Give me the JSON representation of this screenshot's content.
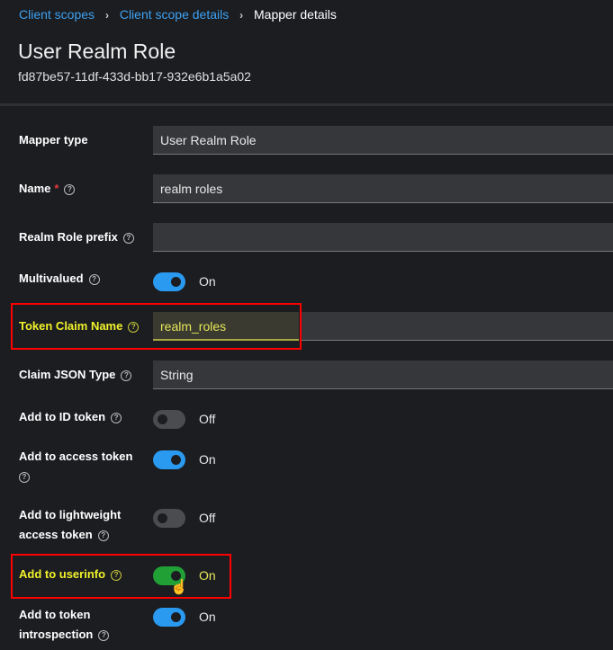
{
  "breadcrumb": [
    "Client scopes",
    "Client scope details",
    "Mapper details"
  ],
  "title": "User Realm Role",
  "id": "fd87be57-11df-433d-bb17-932e6b1a5a02",
  "fields": {
    "mapper_type": {
      "label": "Mapper type",
      "value": "User Realm Role"
    },
    "name": {
      "label": "Name",
      "required": "*",
      "value": "realm roles"
    },
    "prefix": {
      "label": "Realm Role prefix",
      "value": ""
    },
    "multivalued": {
      "label": "Multivalued",
      "state": "On"
    },
    "claim_name": {
      "label": "Token Claim Name",
      "value": "realm_roles"
    },
    "json_type": {
      "label": "Claim JSON Type",
      "value": "String"
    },
    "id_token": {
      "label": "Add to ID token",
      "state": "Off"
    },
    "access_token": {
      "label": "Add to access token",
      "state": "On"
    },
    "lightweight": {
      "label1": "Add to lightweight",
      "label2": "access token",
      "state": "Off"
    },
    "userinfo": {
      "label": "Add to userinfo",
      "state": "On"
    },
    "introspection": {
      "label1": "Add to token",
      "label2": "introspection",
      "state": "On"
    }
  },
  "colors": {
    "accent": "#2a9af0",
    "highlight": "#f2f22a",
    "annotation": "#ff0000",
    "toggle_green": "#21a036"
  }
}
